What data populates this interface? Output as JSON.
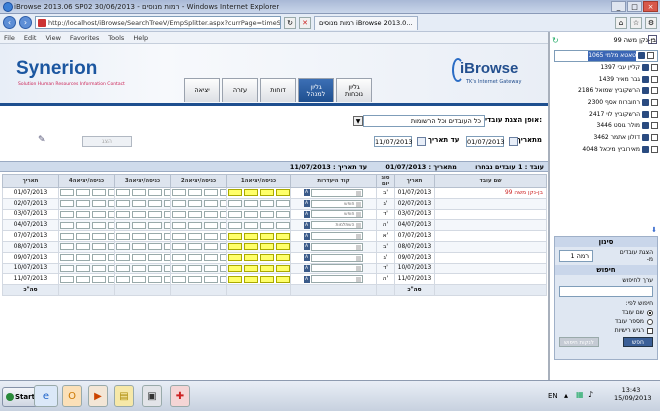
{
  "window": {
    "title": "iBrowse 2013.06 SP02 30/06/2013 - רמות מנוסים - Windows Internet Explorer"
  },
  "browser": {
    "url": "http://localhost/iBrowse/SearchTreeV/EmpSplitter.aspx?currPage=timeSheet/timeSh",
    "tab_label": "רמות מנוסים iBrowse 2013.0...",
    "menu": [
      "File",
      "Edit",
      "View",
      "Favorites",
      "Tools",
      "Help"
    ]
  },
  "app": {
    "brand": "Synerion",
    "brand_sub": "Solution Human Resources Information Contact",
    "product": "iBrowse",
    "product_sub": "TK's Internet Gateway",
    "tabs": [
      {
        "label": "גליון נוכחות"
      },
      {
        "label": "גליון למנהל"
      },
      {
        "label": "דוחות"
      },
      {
        "label": "עזרה"
      },
      {
        "label": "יציאה"
      }
    ],
    "active_tab": 1
  },
  "filter": {
    "view_label": "אופן הצגת עובדים:",
    "view_value": "כל העובדים וכל הרשומות",
    "from_label": "מתאריך",
    "from_value": "01/07/2013",
    "to_label": "עד תאריך",
    "to_value": "11/07/2013",
    "show_label": "הצג"
  },
  "summary": {
    "employee": "עובד : 1 עובדים נבחרו",
    "from": "מתאריך : 01/07/2013",
    "to": "עד תאריך : 11/07/2013"
  },
  "table": {
    "headers": [
      "שם עובד",
      "תאריך",
      "סוג יום",
      "קוד היעדרות",
      "כניסה/יציאה1",
      "כניסה/יציאה2",
      "כניסה/יציאה3",
      "כניסה/יציאה4",
      "תאריך"
    ],
    "employee_name": "99 בן-נקן משה",
    "rows": [
      {
        "date": "01/07/2013",
        "day": "ב'",
        "code": "",
        "yellow": true
      },
      {
        "date": "02/07/2013",
        "day": "ג'",
        "code": "חופש",
        "yellow": false
      },
      {
        "date": "03/07/2013",
        "day": "ד'",
        "code": "חופש",
        "yellow": false
      },
      {
        "date": "04/07/2013",
        "day": "ה'",
        "code": "השתלמות",
        "yellow": false
      },
      {
        "date": "07/07/2013",
        "day": "א'",
        "code": "",
        "yellow": true
      },
      {
        "date": "08/07/2013",
        "day": "ב'",
        "code": "",
        "yellow": true
      },
      {
        "date": "09/07/2013",
        "day": "ג'",
        "code": "",
        "yellow": true
      },
      {
        "date": "10/07/2013",
        "day": "ד'",
        "code": "",
        "yellow": true
      },
      {
        "date": "11/07/2013",
        "day": "ה'",
        "code": "",
        "yellow": true
      }
    ],
    "total_label": "סה\"כ"
  },
  "tree": {
    "root": "בן-נקן משה 99",
    "items": [
      {
        "label": "טאטא מלמי 1065",
        "selected": true
      },
      {
        "label": "קליין עבי 1397",
        "selected": false
      },
      {
        "label": "גבר מאיר 1439",
        "selected": false
      },
      {
        "label": "הרשקוביץ שמואל 2186",
        "selected": false
      },
      {
        "label": "רחוברוח אסף 2300",
        "selected": false
      },
      {
        "label": "הרשקוביץ לוי 2417",
        "selected": false
      },
      {
        "label": "מולר גוסט 3446",
        "selected": false
      },
      {
        "label": "דזלון אתמר 3462",
        "selected": false
      },
      {
        "label": "מאירוביץ מיכאל 4048",
        "selected": false
      }
    ]
  },
  "side": {
    "filter_title": "סינון",
    "filter_label": "הצגת עובדים מ-",
    "filter_value": "רמה 1",
    "search_title": "חיפוש",
    "search_value_label": "ערך לחיפוש",
    "search_by_label": "חיפוש לפי:",
    "opt1": "שם עובד",
    "opt2": "מספר עובד",
    "opt3": "רגיש רישיות",
    "btn_search": "חפש",
    "btn_clear": "לנקות חיפוש"
  },
  "taskbar": {
    "start": "Start",
    "lang": "EN",
    "time": "13:43",
    "date": "15/09/2013"
  }
}
